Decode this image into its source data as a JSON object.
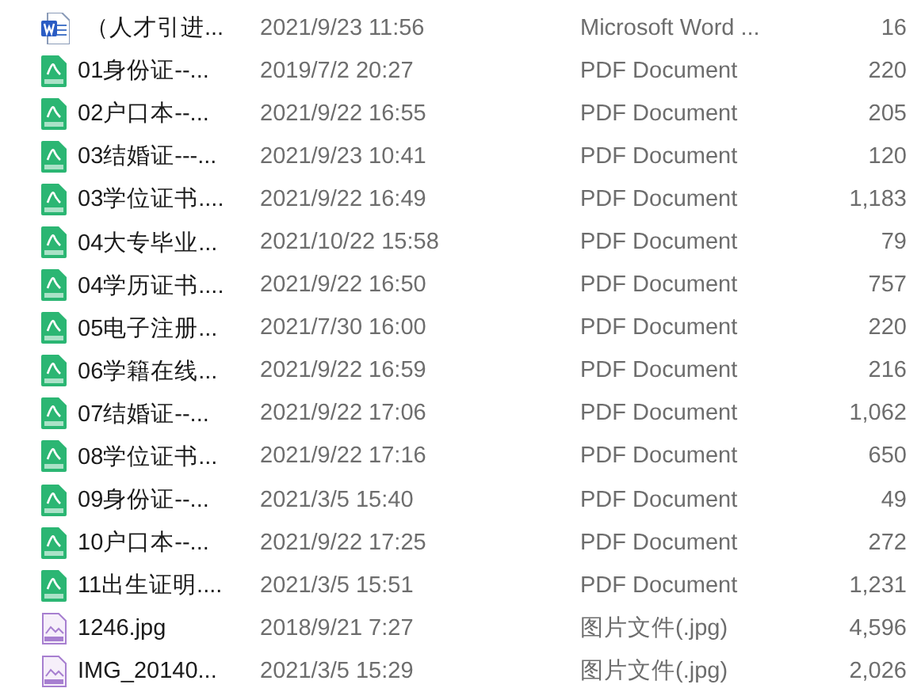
{
  "files": [
    {
      "kind": "word",
      "name": "（人才引进...",
      "modified": "2021/9/23 11:56",
      "type": "Microsoft Word ...",
      "size": "16"
    },
    {
      "kind": "pdf",
      "name": "01身份证--...",
      "modified": "2019/7/2 20:27",
      "type": "PDF Document",
      "size": "220"
    },
    {
      "kind": "pdf",
      "name": "02户口本--...",
      "modified": "2021/9/22 16:55",
      "type": "PDF Document",
      "size": "205"
    },
    {
      "kind": "pdf",
      "name": "03结婚证---...",
      "modified": "2021/9/23 10:41",
      "type": "PDF Document",
      "size": "120"
    },
    {
      "kind": "pdf",
      "name": "03学位证书....",
      "modified": "2021/9/22 16:49",
      "type": "PDF Document",
      "size": "1,183"
    },
    {
      "kind": "pdf",
      "name": "04大专毕业...",
      "modified": "2021/10/22 15:58",
      "type": "PDF Document",
      "size": "79"
    },
    {
      "kind": "pdf",
      "name": "04学历证书....",
      "modified": "2021/9/22 16:50",
      "type": "PDF Document",
      "size": "757"
    },
    {
      "kind": "pdf",
      "name": "05电子注册...",
      "modified": "2021/7/30 16:00",
      "type": "PDF Document",
      "size": "220"
    },
    {
      "kind": "pdf",
      "name": "06学籍在线...",
      "modified": "2021/9/22 16:59",
      "type": "PDF Document",
      "size": "216"
    },
    {
      "kind": "pdf",
      "name": "07结婚证--...",
      "modified": "2021/9/22 17:06",
      "type": "PDF Document",
      "size": "1,062"
    },
    {
      "kind": "pdf",
      "name": "08学位证书...",
      "modified": "2021/9/22 17:16",
      "type": "PDF Document",
      "size": "650"
    },
    {
      "kind": "pdf",
      "name": "09身份证--...",
      "modified": "2021/3/5 15:40",
      "type": "PDF Document",
      "size": "49"
    },
    {
      "kind": "pdf",
      "name": "10户口本--...",
      "modified": "2021/9/22 17:25",
      "type": "PDF Document",
      "size": "272"
    },
    {
      "kind": "pdf",
      "name": "11出生证明....",
      "modified": "2021/3/5 15:51",
      "type": "PDF Document",
      "size": "1,231"
    },
    {
      "kind": "image",
      "name": "1246.jpg",
      "modified": "2018/9/21 7:27",
      "type": "图片文件(.jpg)",
      "size": "4,596"
    },
    {
      "kind": "image",
      "name": "IMG_20140...",
      "modified": "2021/3/5 15:29",
      "type": "图片文件(.jpg)",
      "size": "2,026"
    }
  ]
}
